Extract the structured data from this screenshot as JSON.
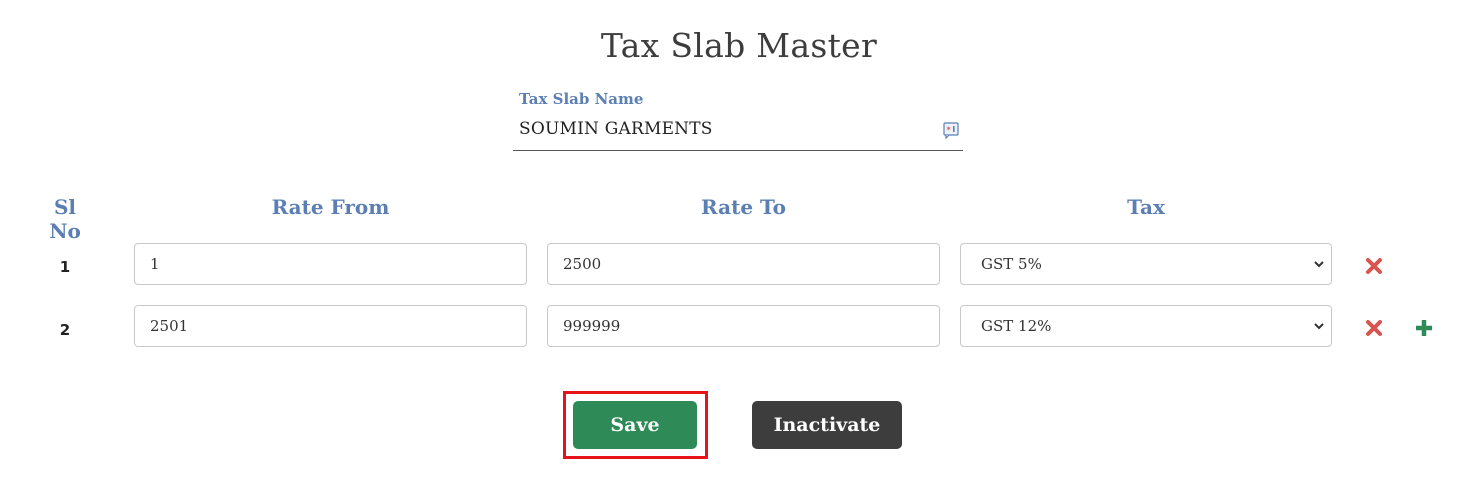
{
  "page": {
    "title": "Tax Slab Master"
  },
  "slab_name": {
    "label": "Tax Slab Name",
    "value": "SOUMIN GARMENTS",
    "icon": "form-badge-icon"
  },
  "table": {
    "headers": {
      "sl_no": "Sl No",
      "rate_from": "Rate From",
      "rate_to": "Rate To",
      "tax": "Tax"
    },
    "rows": [
      {
        "sl_no": "1",
        "rate_from": "1",
        "rate_to": "2500",
        "tax": "GST 5%"
      },
      {
        "sl_no": "2",
        "rate_from": "2501",
        "rate_to": "999999",
        "tax": "GST 12%"
      }
    ]
  },
  "actions": {
    "save_label": "Save",
    "inactivate_label": "Inactivate"
  },
  "colors": {
    "accent_blue": "#5b7fb3",
    "save_green": "#2e8b57",
    "inactivate_dark": "#3d3d3d",
    "delete_red": "#d9534f",
    "add_green": "#2e8b57",
    "highlight_red": "#e8121b"
  }
}
